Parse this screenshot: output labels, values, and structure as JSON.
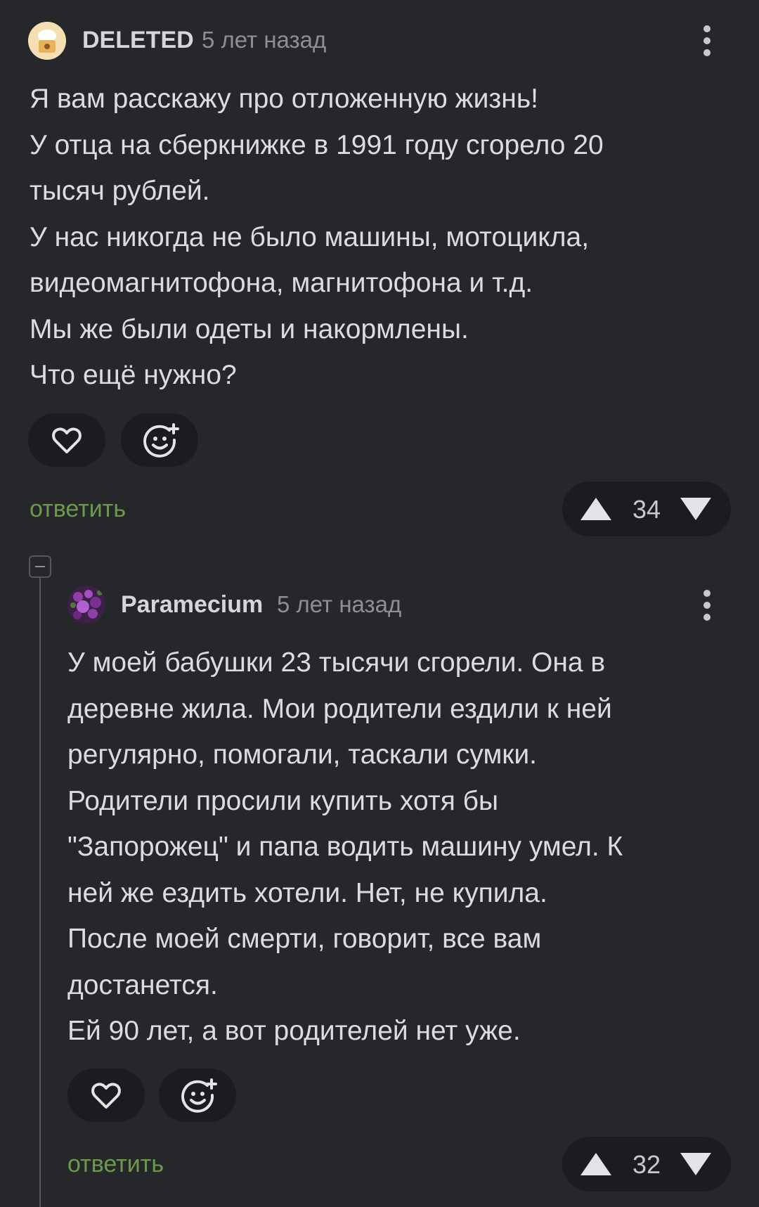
{
  "comment1": {
    "username": "DELETED",
    "time": "5 лет назад",
    "lines": [
      "Я вам расскажу про отложенную жизнь!",
      "У отца на сберкнижке в 1991 году сгорело 20",
      "тысяч рублей.",
      "У нас никогда не было машины, мотоцикла,",
      "видеомагнитофона, магнитофона и т.д.",
      "Мы же были одеты и накормлены.",
      "Что ещё нужно?"
    ],
    "reply_label": "ответить",
    "votes": "34"
  },
  "comment2": {
    "username": "Paramecium",
    "time": "5 лет назад",
    "lines": [
      "У моей бабушки 23 тысячи сгорели. Она в",
      "деревне жила. Мои родители ездили к ней",
      "регулярно, помогали, таскали сумки.",
      "Родители просили купить хотя бы",
      "\"Запорожец\" и папа водить машину умел. К",
      "ней же ездить хотели. Нет, не купила.",
      "После моей смерти, говорит, все вам",
      "достанется.",
      "Ей 90 лет, а вот родителей нет уже."
    ],
    "reply_label": "ответить",
    "votes": "32"
  },
  "icons": {
    "like": "heart-icon",
    "react": "smiley-plus-icon",
    "more": "more-vertical-icon",
    "upvote": "triangle-up-icon",
    "downvote": "triangle-down-icon",
    "collapse": "minus-square-icon"
  },
  "colors": {
    "background": "#26272b",
    "pill": "#1b1c1f",
    "reply_link": "#6d9a4a",
    "thread_line": "#55565b"
  }
}
